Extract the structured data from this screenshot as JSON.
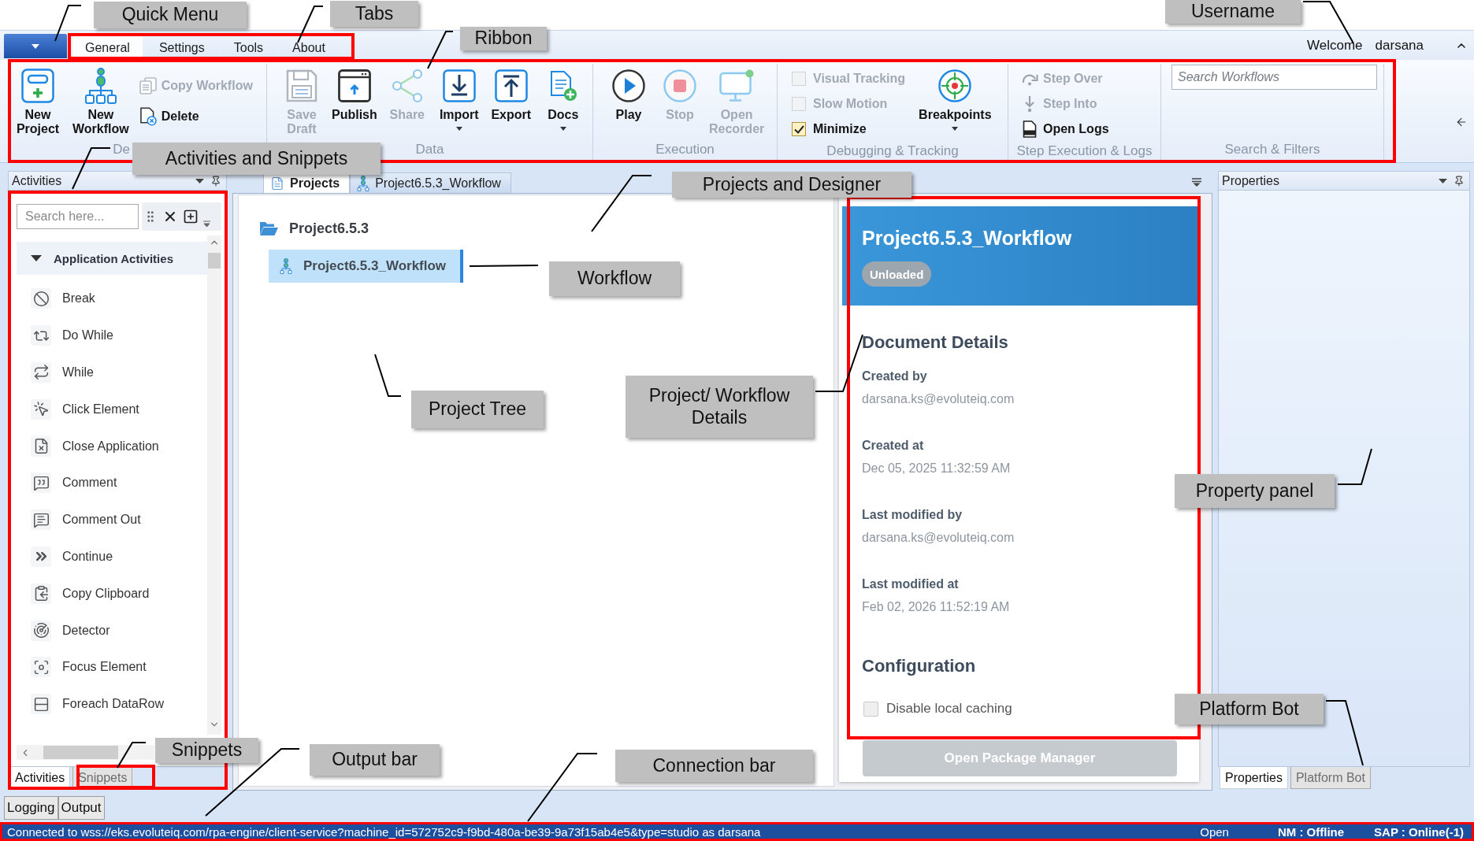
{
  "tabs": [
    {
      "label": "General",
      "selected": true
    },
    {
      "label": "Settings",
      "selected": false
    },
    {
      "label": "Tools",
      "selected": false
    },
    {
      "label": "About",
      "selected": false
    }
  ],
  "user": {
    "greeting": "Welcome",
    "name": "darsana"
  },
  "ribbon": {
    "groups": [
      {
        "label": "De",
        "items": [
          {
            "kind": "large",
            "label": "New Project",
            "disabled": false,
            "dropdown": false
          },
          {
            "kind": "large",
            "label": "New Workflow",
            "disabled": false,
            "dropdown": false
          },
          {
            "kind": "small",
            "label": "Copy Workflow",
            "disabled": true
          },
          {
            "kind": "small",
            "label": "Delete",
            "disabled": false
          }
        ]
      },
      {
        "label": "Data",
        "items": [
          {
            "kind": "large",
            "label": "Save Draft",
            "disabled": true,
            "dropdown": false
          },
          {
            "kind": "large",
            "label": "Publish",
            "disabled": false,
            "dropdown": false
          },
          {
            "kind": "large",
            "label": "Share",
            "disabled": true,
            "dropdown": false
          },
          {
            "kind": "large",
            "label": "Import",
            "disabled": false,
            "dropdown": true
          },
          {
            "kind": "large",
            "label": "Export",
            "disabled": false,
            "dropdown": false
          },
          {
            "kind": "large",
            "label": "Docs",
            "disabled": false,
            "dropdown": true
          }
        ]
      },
      {
        "label": "Execution",
        "items": [
          {
            "kind": "large",
            "label": "Play",
            "disabled": false,
            "dropdown": false
          },
          {
            "kind": "large",
            "label": "Stop",
            "disabled": true,
            "dropdown": false
          },
          {
            "kind": "large",
            "label": "Open Recorder",
            "disabled": true,
            "dropdown": false
          }
        ]
      },
      {
        "label": "Debugging & Tracking",
        "items": [
          {
            "kind": "check",
            "label": "Visual Tracking",
            "checked": false,
            "disabled": true
          },
          {
            "kind": "check",
            "label": "Slow Motion",
            "checked": false,
            "disabled": true
          },
          {
            "kind": "check",
            "label": "Minimize",
            "checked": true,
            "disabled": false
          },
          {
            "kind": "large",
            "label": "Breakpoints",
            "disabled": false,
            "dropdown": true
          }
        ]
      },
      {
        "label": "Step Execution & Logs",
        "items": [
          {
            "kind": "small",
            "label": "Step Over",
            "disabled": true
          },
          {
            "kind": "small",
            "label": "Step Into",
            "disabled": true
          },
          {
            "kind": "small",
            "label": "Open Logs",
            "disabled": false
          }
        ]
      },
      {
        "label": "Search & Filters",
        "items": [
          {
            "kind": "search",
            "placeholder": "Search Workflows"
          }
        ]
      }
    ]
  },
  "activities": {
    "title": "Activities",
    "search_placeholder": "Search here...",
    "category": {
      "label": "Application Activities",
      "expanded": true
    },
    "items": [
      {
        "label": "Break"
      },
      {
        "label": "Do While"
      },
      {
        "label": "While"
      },
      {
        "label": "Click Element"
      },
      {
        "label": "Close Application"
      },
      {
        "label": "Comment"
      },
      {
        "label": "Comment Out"
      },
      {
        "label": "Continue"
      },
      {
        "label": "Copy Clipboard"
      },
      {
        "label": "Detector"
      },
      {
        "label": "Focus Element"
      },
      {
        "label": "Foreach DataRow"
      }
    ],
    "tabs": [
      {
        "label": "Activities",
        "selected": true
      },
      {
        "label": "Snippets",
        "selected": false
      }
    ]
  },
  "documents": {
    "tabs": [
      {
        "label": "Projects",
        "selected": true
      },
      {
        "label": "Project6.5.3_Workflow",
        "selected": false
      }
    ],
    "tree": [
      {
        "label": "Project6.5.3",
        "expanded": true,
        "children": [
          {
            "label": "Project6.5.3_Workflow",
            "selected": true
          }
        ]
      }
    ]
  },
  "details": {
    "title": "Project6.5.3_Workflow",
    "status": "Unloaded",
    "sections": [
      {
        "heading": "Document Details",
        "fields": [
          {
            "label": "Created by",
            "value": "darsana.ks@evoluteiq.com"
          },
          {
            "label": "Created at",
            "value": "Dec 05, 2025 11:32:59 AM"
          },
          {
            "label": "Last modified by",
            "value": "darsana.ks@evoluteiq.com"
          },
          {
            "label": "Last modified at",
            "value": "Feb 02, 2026 11:52:19 AM"
          }
        ]
      },
      {
        "heading": "Configuration",
        "options": [
          {
            "label": "Disable local caching",
            "checked": false
          }
        ]
      }
    ],
    "button": {
      "label": "Open Package Manager",
      "disabled": true
    }
  },
  "properties": {
    "title": "Properties",
    "tabs": [
      {
        "label": "Properties",
        "selected": true
      },
      {
        "label": "Platform Bot",
        "selected": false
      }
    ]
  },
  "output_tabs": [
    {
      "label": "Logging",
      "selected": false
    },
    {
      "label": "Output",
      "selected": false
    }
  ],
  "status_bar": {
    "connection": "Connected to wss://eks.evoluteiq.com/rpa-engine/client-service?machine_id=572752c9-f9bd-480a-be39-9a73f15ab4e5&type=studio as darsana",
    "state": "Open",
    "nm": "NM : Offline",
    "sap": "SAP : Online(-1)"
  },
  "annotations": [
    {
      "text": "Quick Menu"
    },
    {
      "text": "Tabs"
    },
    {
      "text": "Username"
    },
    {
      "text": "Ribbon"
    },
    {
      "text": "Activities and Snippets"
    },
    {
      "text": "Projects and Designer"
    },
    {
      "text": "Workflow"
    },
    {
      "text": "Project Tree"
    },
    {
      "text": "Project/ Workflow Details"
    },
    {
      "text": "Property panel"
    },
    {
      "text": "Platform Bot"
    },
    {
      "text": "Snippets"
    },
    {
      "text": "Output bar"
    },
    {
      "text": "Connection bar"
    }
  ]
}
